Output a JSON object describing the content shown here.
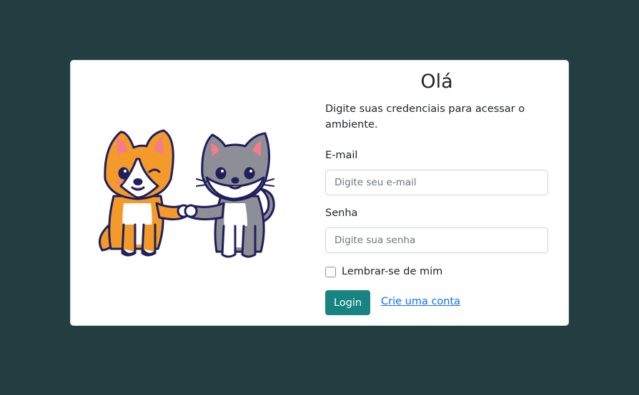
{
  "login": {
    "title": "Olá",
    "subtitle": "Digite suas credenciais para acessar o ambiente.",
    "email_label": "E-mail",
    "email_placeholder": "Digite seu e-mail",
    "email_value": "",
    "password_label": "Senha",
    "password_placeholder": "Digite sua senha",
    "password_value": "",
    "remember_label": "Lembrar-se de mim",
    "remember_checked": false,
    "login_button": "Login",
    "signup_link": "Crie uma conta"
  },
  "illustration": {
    "subject": "cartoon corgi and cat fist bump",
    "icons": [
      "corgi-dog-icon",
      "gray-cat-icon"
    ]
  },
  "colors": {
    "background": "#233e40",
    "card": "#ffffff",
    "primary_button": "#178482",
    "link": "#0d6efd",
    "dog_orange": "#f39a2b",
    "cat_gray": "#8e8e96",
    "outline": "#1e1f5c"
  }
}
